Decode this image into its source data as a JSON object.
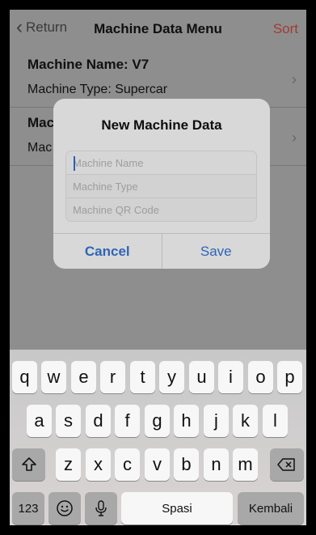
{
  "nav": {
    "back_label": "Return",
    "title": "Machine Data Menu",
    "sort_label": "Sort"
  },
  "list": [
    {
      "title": "Machine Name: V7",
      "subtitle": "Machine Type: Supercar"
    },
    {
      "title": "Mac",
      "subtitle": "Mac"
    }
  ],
  "dialog": {
    "title": "New Machine Data",
    "fields": [
      {
        "placeholder": "Machine Name",
        "value": ""
      },
      {
        "placeholder": "Machine Type",
        "value": ""
      },
      {
        "placeholder": "Machine QR Code",
        "value": ""
      }
    ],
    "cancel_label": "Cancel",
    "save_label": "Save"
  },
  "keyboard": {
    "row1": [
      "q",
      "w",
      "e",
      "r",
      "t",
      "y",
      "u",
      "i",
      "o",
      "p"
    ],
    "row2": [
      "a",
      "s",
      "d",
      "f",
      "g",
      "h",
      "j",
      "k",
      "l"
    ],
    "row3": [
      "z",
      "x",
      "c",
      "v",
      "b",
      "n",
      "m"
    ],
    "numbers_label": "123",
    "space_label": "Spasi",
    "return_label": "Kembali"
  },
  "colors": {
    "accent": "#2f64b8",
    "sort": "#a33a33"
  }
}
